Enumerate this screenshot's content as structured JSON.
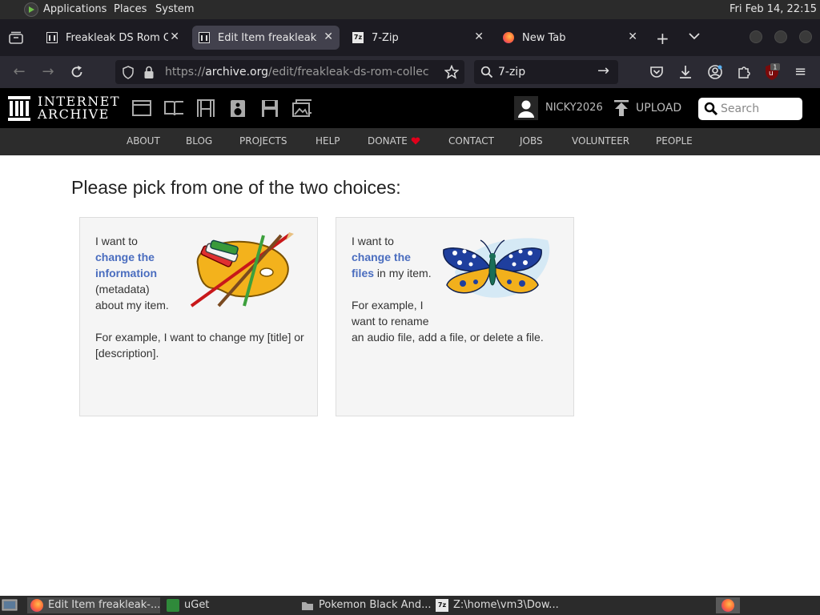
{
  "os_bar": {
    "menus": [
      "Applications",
      "Places",
      "System"
    ],
    "clock": "Fri Feb 14, 22:15"
  },
  "tabs": [
    {
      "title": "Freakleak DS Rom Co",
      "favicon": "internet-archive-icon",
      "active": false
    },
    {
      "title": "Edit Item freakleak-d",
      "favicon": "internet-archive-icon",
      "active": true
    },
    {
      "title": "7-Zip",
      "favicon": "7zip-icon",
      "active": false
    },
    {
      "title": "New Tab",
      "favicon": "firefox-icon",
      "active": false
    }
  ],
  "nav": {
    "url_prefix": "https://",
    "url_host": "archive.org",
    "url_path": "/edit/freakleak-ds-rom-collection",
    "search_query": "7-zip"
  },
  "ia_header": {
    "logo_line1": "INTERNET",
    "logo_line2": "ARCHIVE",
    "username": "NICKY2026",
    "upload": "UPLOAD",
    "search_placeholder": "Search"
  },
  "ia_nav": [
    "ABOUT",
    "BLOG",
    "PROJECTS",
    "HELP",
    "DONATE",
    "CONTACT",
    "JOBS",
    "VOLUNTEER",
    "PEOPLE"
  ],
  "main": {
    "title": "Please pick from one of the two choices:",
    "cards": [
      {
        "line1": "I want to",
        "link_l1": "change the",
        "link_l2": "information",
        "line2": "(metadata)",
        "line3": "about my item.",
        "example": "For example, I want to change my [title] or [description]."
      },
      {
        "line1": "I want to",
        "link_l1": "change the",
        "link_l2": "files",
        "line2": " in my item.",
        "ex1": "For example, I",
        "ex2": "want to rename",
        "ex3": "an audio file, add a file, or delete a file."
      }
    ]
  },
  "taskbar": [
    {
      "label": "Edit Item freakleak-...",
      "icon": "firefox-icon",
      "active": true
    },
    {
      "label": "uGet",
      "icon": "uget-icon",
      "active": false
    },
    {
      "label": "Pokemon Black And...",
      "icon": "folder-icon",
      "active": false
    },
    {
      "label": "Z:\\home\\vm3\\Dow...",
      "icon": "7zip-icon",
      "active": false
    }
  ],
  "colors": {
    "link": "#4a6dbf",
    "ia_black": "#000000",
    "donate_heart": "#e0001b"
  }
}
